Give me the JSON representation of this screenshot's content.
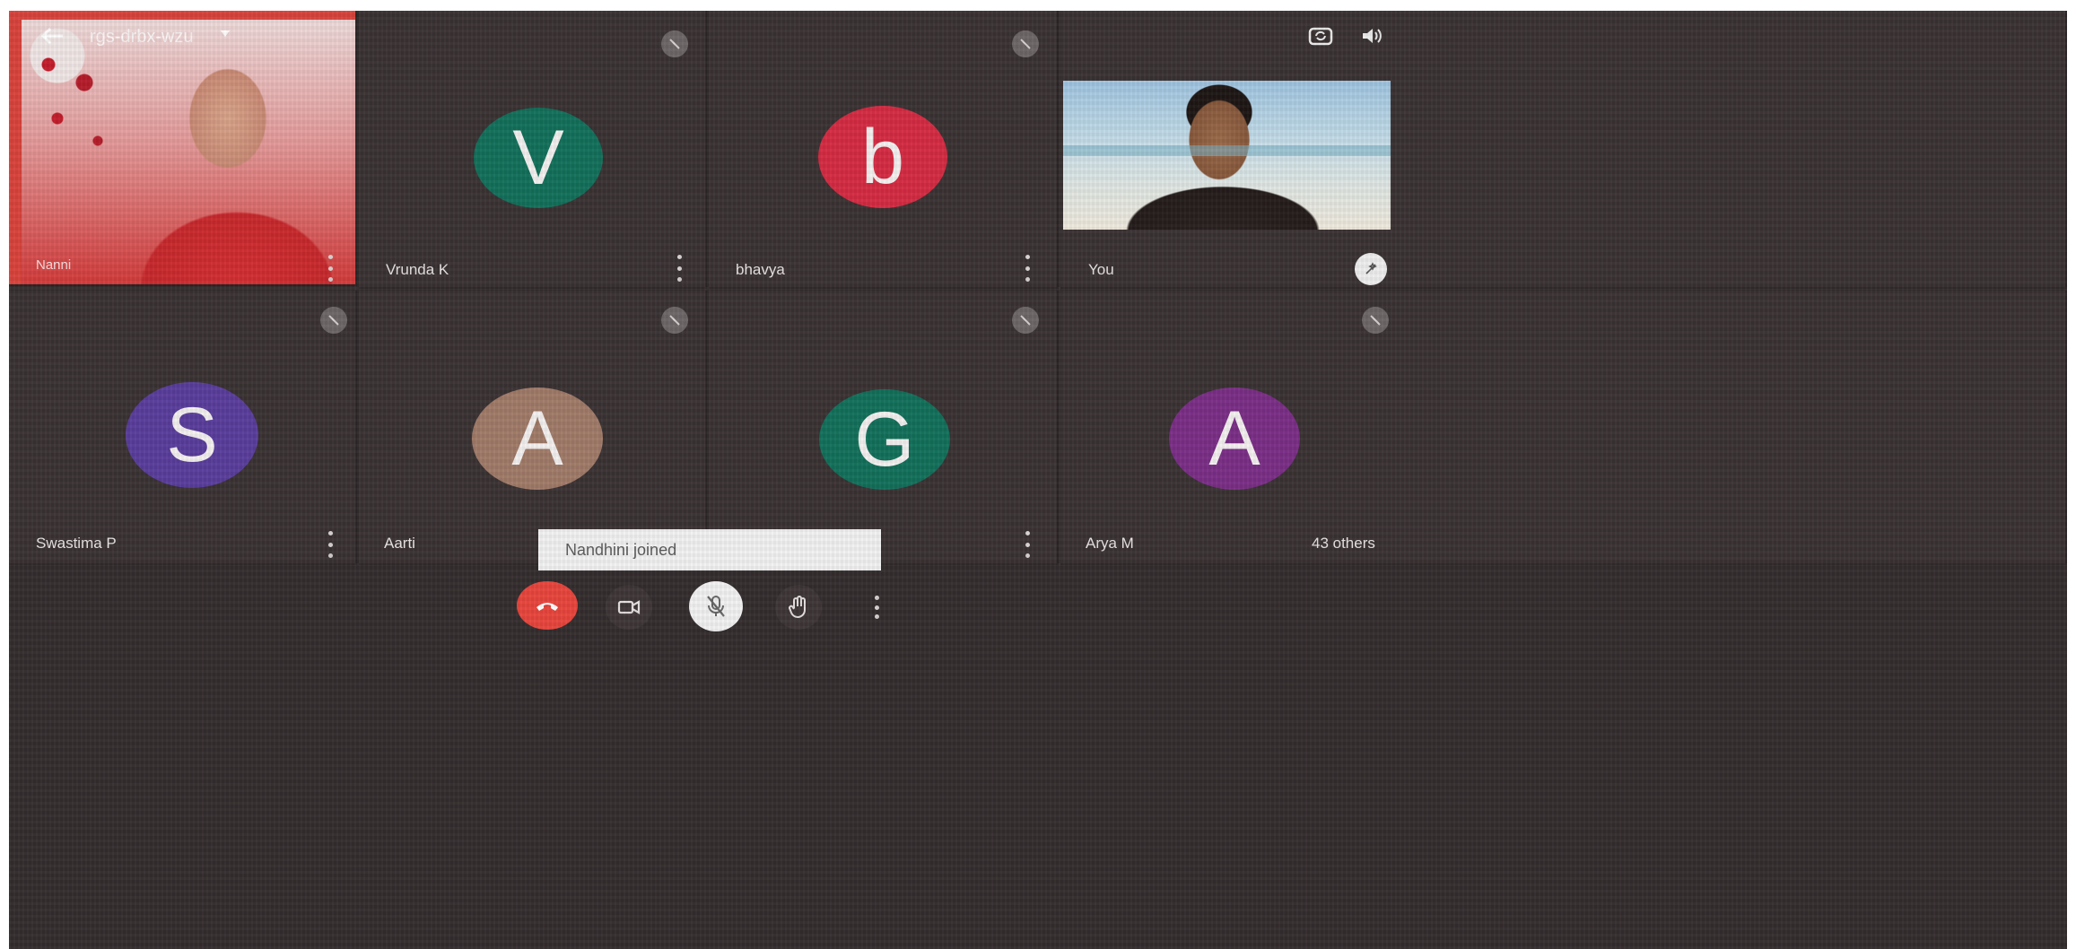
{
  "meeting": {
    "code": "rgs-drbx-wzu"
  },
  "participants": [
    {
      "id": "p1",
      "name": "Nanni",
      "initial": "",
      "color": "",
      "video": true
    },
    {
      "id": "p2",
      "name": "Vrunda K",
      "initial": "V",
      "color": "#12705a",
      "video": false
    },
    {
      "id": "p3",
      "name": "bhavya",
      "initial": "b",
      "color": "#d42b42",
      "video": false
    },
    {
      "id": "p4",
      "name": "You",
      "initial": "",
      "color": "",
      "video": true
    },
    {
      "id": "p5",
      "name": "Swastima P",
      "initial": "S",
      "color": "#5a3d9c",
      "video": false
    },
    {
      "id": "p6",
      "name": "Aarti",
      "initial": "A",
      "color": "#a07a68",
      "video": false
    },
    {
      "id": "p7",
      "name": "",
      "initial": "G",
      "color": "#12705a",
      "video": false
    },
    {
      "id": "p8",
      "name": "Arya M",
      "initial": "A",
      "color": "#7a2e86",
      "video": false
    }
  ],
  "others_count_label": "43 others",
  "toast": {
    "text": "Nandhini joined"
  },
  "controls": {
    "end_call_color": "#e8453c",
    "mic_bg": "#f2f2f2"
  },
  "icons": {
    "back": "arrow-left-icon",
    "camera_switch": "camera-switch-icon",
    "speaker": "speaker-icon",
    "end_call": "phone-hangup-icon",
    "camera": "camera-icon",
    "mic_off": "mic-off-icon",
    "hand": "raise-hand-icon",
    "more": "more-vert-icon"
  }
}
